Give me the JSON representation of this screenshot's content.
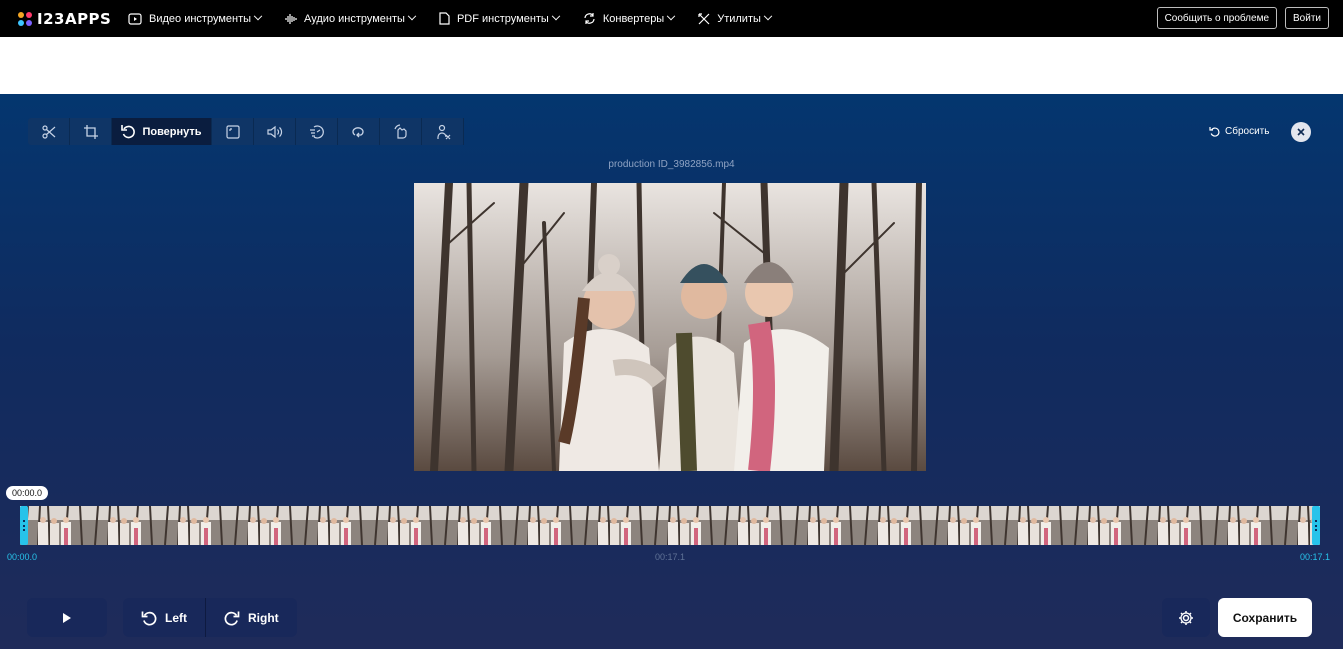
{
  "brand": {
    "name": "I23APPS",
    "dot_colors": [
      "#f5a623",
      "#ff3b6b",
      "#3ec5ff",
      "#7b61ff"
    ]
  },
  "nav": {
    "items": [
      {
        "label": "Видео инструменты",
        "icon": "video-icon"
      },
      {
        "label": "Аудио инструменты",
        "icon": "audio-icon"
      },
      {
        "label": "PDF инструменты",
        "icon": "pdf-icon"
      },
      {
        "label": "Конвертеры",
        "icon": "convert-icon"
      },
      {
        "label": "Утилиты",
        "icon": "tools-icon"
      }
    ],
    "report_label": "Сообщить о проблеме",
    "login_label": "Войти"
  },
  "editor": {
    "toolbar": {
      "active_tool_label": "Повернуть",
      "tools": [
        "scissors-icon",
        "crop-icon",
        "rotate-icon",
        "resize-icon",
        "volume-icon",
        "speed-icon",
        "loop-icon",
        "flip-icon",
        "remove-audio-icon"
      ]
    },
    "reset_label": "Сбросить",
    "filename": "production ID_3982856.mp4",
    "timeline": {
      "current_time": "00:00.0",
      "start_label": "00:00.0",
      "middle_label": "00:17.1",
      "end_label": "00:17.1"
    },
    "controls": {
      "rotate_left_label": "Left",
      "rotate_right_label": "Right",
      "save_label": "Сохранить"
    }
  },
  "colors": {
    "accent": "#27c3ea",
    "bg_top": "#04366f",
    "bg_bottom": "#1f2b5a",
    "panel": "#18285a"
  }
}
